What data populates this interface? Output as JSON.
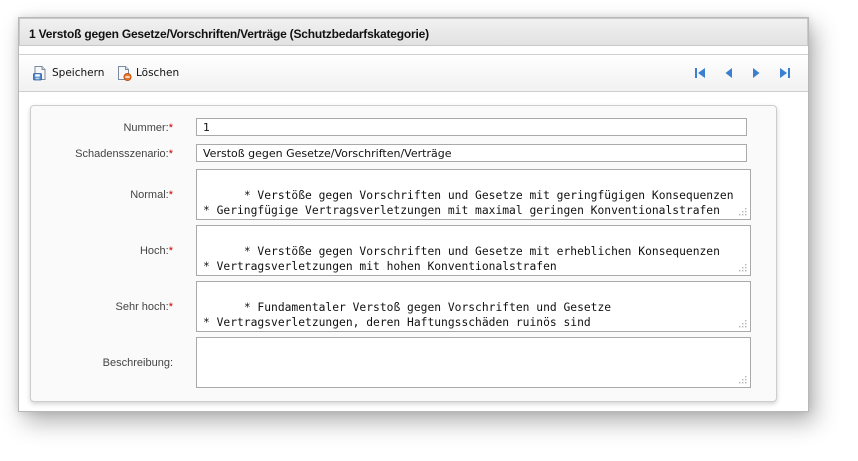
{
  "window": {
    "title": "1 Verstoß gegen Gesetze/Vorschriften/Verträge (Schutzbedarfskategorie)"
  },
  "toolbar": {
    "save_label": "Speichern",
    "delete_label": "Löschen",
    "save_icon": "save-document-icon",
    "delete_icon": "delete-document-icon",
    "nav_icons": [
      "first-record-icon",
      "previous-record-icon",
      "next-record-icon",
      "last-record-icon"
    ]
  },
  "form": {
    "required_marker": "*",
    "fields": {
      "nummer": {
        "label": "Nummer:",
        "value": "1",
        "required": true
      },
      "schadensszenario": {
        "label": "Schadensszenario:",
        "value": "Verstoß gegen Gesetze/Vorschriften/Verträge",
        "required": true
      },
      "normal": {
        "label": "Normal:",
        "value": "* Verstöße gegen Vorschriften und Gesetze mit geringfügigen Konsequenzen\n* Geringfügige Vertragsverletzungen mit maximal geringen Konventionalstrafen",
        "required": true
      },
      "hoch": {
        "label": "Hoch:",
        "value": "* Verstöße gegen Vorschriften und Gesetze mit erheblichen Konsequenzen\n* Vertragsverletzungen mit hohen Konventionalstrafen",
        "required": true
      },
      "sehr_hoch": {
        "label": "Sehr hoch:",
        "value": "* Fundamentaler Verstoß gegen Vorschriften und Gesetze\n* Vertragsverletzungen, deren Haftungsschäden ruinös sind",
        "required": true
      },
      "beschreibung": {
        "label": "Beschreibung:",
        "value": "",
        "required": false
      }
    }
  },
  "colors": {
    "required": "#c00000",
    "nav_blue": "#3a7fd0"
  }
}
